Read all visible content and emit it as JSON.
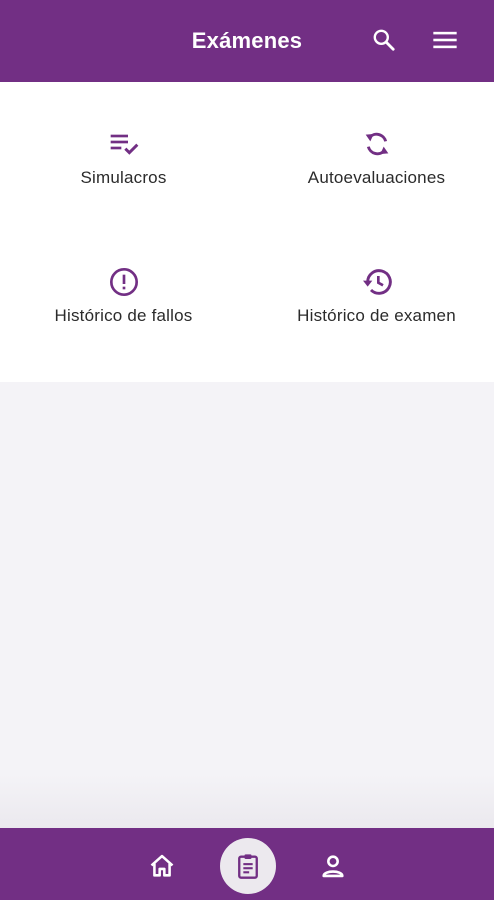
{
  "header": {
    "title": "Exámenes",
    "search_icon": "search-icon",
    "menu_icon": "menu-icon",
    "color": "#722f84"
  },
  "tiles": [
    {
      "label": "Simulacros",
      "icon": "playlist-check-icon"
    },
    {
      "label": "Autoevaluaciones",
      "icon": "sync-icon"
    },
    {
      "label": "Histórico de fallos",
      "icon": "alert-circle-icon"
    },
    {
      "label": "Histórico de examen",
      "icon": "history-icon"
    }
  ],
  "bottom_nav": {
    "items": [
      {
        "icon": "home-icon",
        "active": false
      },
      {
        "icon": "clipboard-icon",
        "active": true
      },
      {
        "icon": "person-icon",
        "active": false
      }
    ],
    "active_bg": "#ece9ee"
  },
  "colors": {
    "primary": "#722f84",
    "surface": "#ffffff",
    "background": "#f4f3f7"
  }
}
